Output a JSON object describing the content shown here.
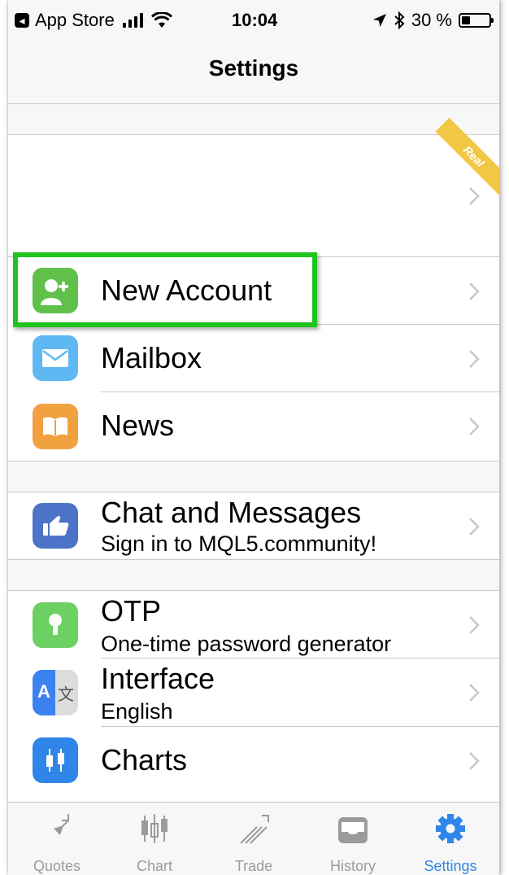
{
  "status_bar": {
    "back_app": "App Store",
    "time": "10:04",
    "battery_text": "30 %",
    "battery_level": 0.3
  },
  "nav": {
    "title": "Settings"
  },
  "account": {
    "badge": "Real"
  },
  "menu": {
    "new_account": "New Account",
    "mailbox": "Mailbox",
    "news": "News",
    "chat_title": "Chat and Messages",
    "chat_subtitle": "Sign in to MQL5.community!",
    "otp_title": "OTP",
    "otp_subtitle": "One-time password generator",
    "interface_title": "Interface",
    "interface_subtitle": "English",
    "charts": "Charts"
  },
  "tabs": [
    "Quotes",
    "Chart",
    "Trade",
    "History",
    "Settings"
  ],
  "active_tab": "Settings",
  "colors": {
    "highlight": "#1fc41f",
    "new_account_icon": "#5fc04a",
    "mailbox_icon": "#5fb8f2",
    "news_icon": "#f2a141",
    "chat_icon": "#4d73c8",
    "otp_icon": "#6cd062",
    "interface_icon": "#3b82f0",
    "charts_icon": "#2f86e8",
    "tab_active": "#2f86e8",
    "tab_inactive": "#9b9b9b"
  }
}
